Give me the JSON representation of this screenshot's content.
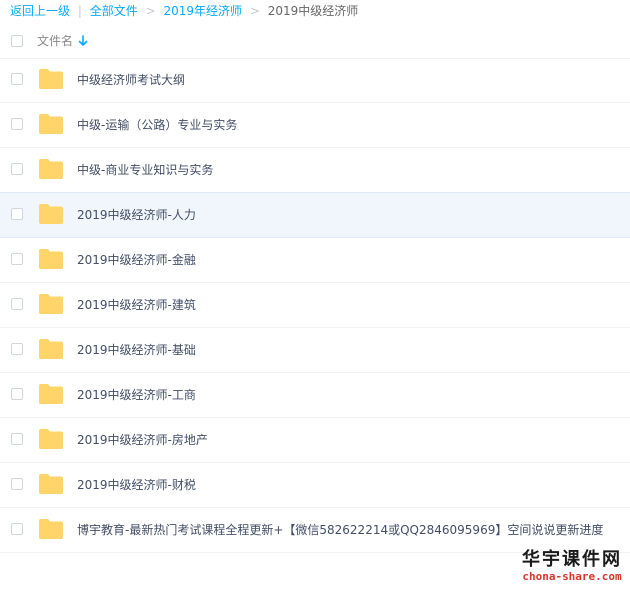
{
  "breadcrumb": {
    "back_label": "返回上一级",
    "separator": "|",
    "all_files_label": "全部文件",
    "chevron": ">",
    "level1_label": "2019年经济师",
    "current_label": "2019中级经济师"
  },
  "header": {
    "column_name": "文件名",
    "sort_icon": "arrow-down-icon",
    "accent_color": "#09aaff"
  },
  "rows": [
    {
      "name": "中级经济师考试大纲"
    },
    {
      "name": "中级-运输（公路）专业与实务"
    },
    {
      "name": "中级-商业专业知识与实务"
    },
    {
      "name": "2019中级经济师-人力"
    },
    {
      "name": "2019中级经济师-金融"
    },
    {
      "name": "2019中级经济师-建筑"
    },
    {
      "name": "2019中级经济师-基础"
    },
    {
      "name": "2019中级经济师-工商"
    },
    {
      "name": "2019中级经济师-房地产"
    },
    {
      "name": "2019中级经济师-财税"
    },
    {
      "name": "博宇教育-最新热门考试课程全程更新+【微信582622214或QQ2846095969】空间说说更新进度"
    }
  ],
  "hover_row_index": 3,
  "folder_color": "#ffd56a",
  "watermark": {
    "title": "华宇课件网",
    "url": "chona-share.com"
  }
}
